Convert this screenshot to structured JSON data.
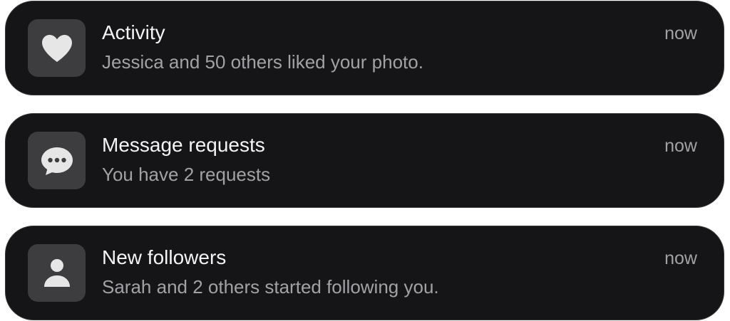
{
  "notifications": [
    {
      "icon": "heart-icon",
      "title": "Activity",
      "subtitle": "Jessica and 50 others liked your photo.",
      "time": "now"
    },
    {
      "icon": "chat-bubble-icon",
      "title": "Message requests",
      "subtitle": "You have 2 requests",
      "time": "now"
    },
    {
      "icon": "person-icon",
      "title": "New followers",
      "subtitle": "Sarah and 2 others started following you.",
      "time": "now"
    }
  ],
  "colors": {
    "card_background": "#151517",
    "card_border": "#38383b",
    "icon_tile": "#3d3d3f",
    "icon_glyph": "#e6e6e6",
    "title_text": "#f4f4f5",
    "secondary_text": "#a2a2a6"
  }
}
